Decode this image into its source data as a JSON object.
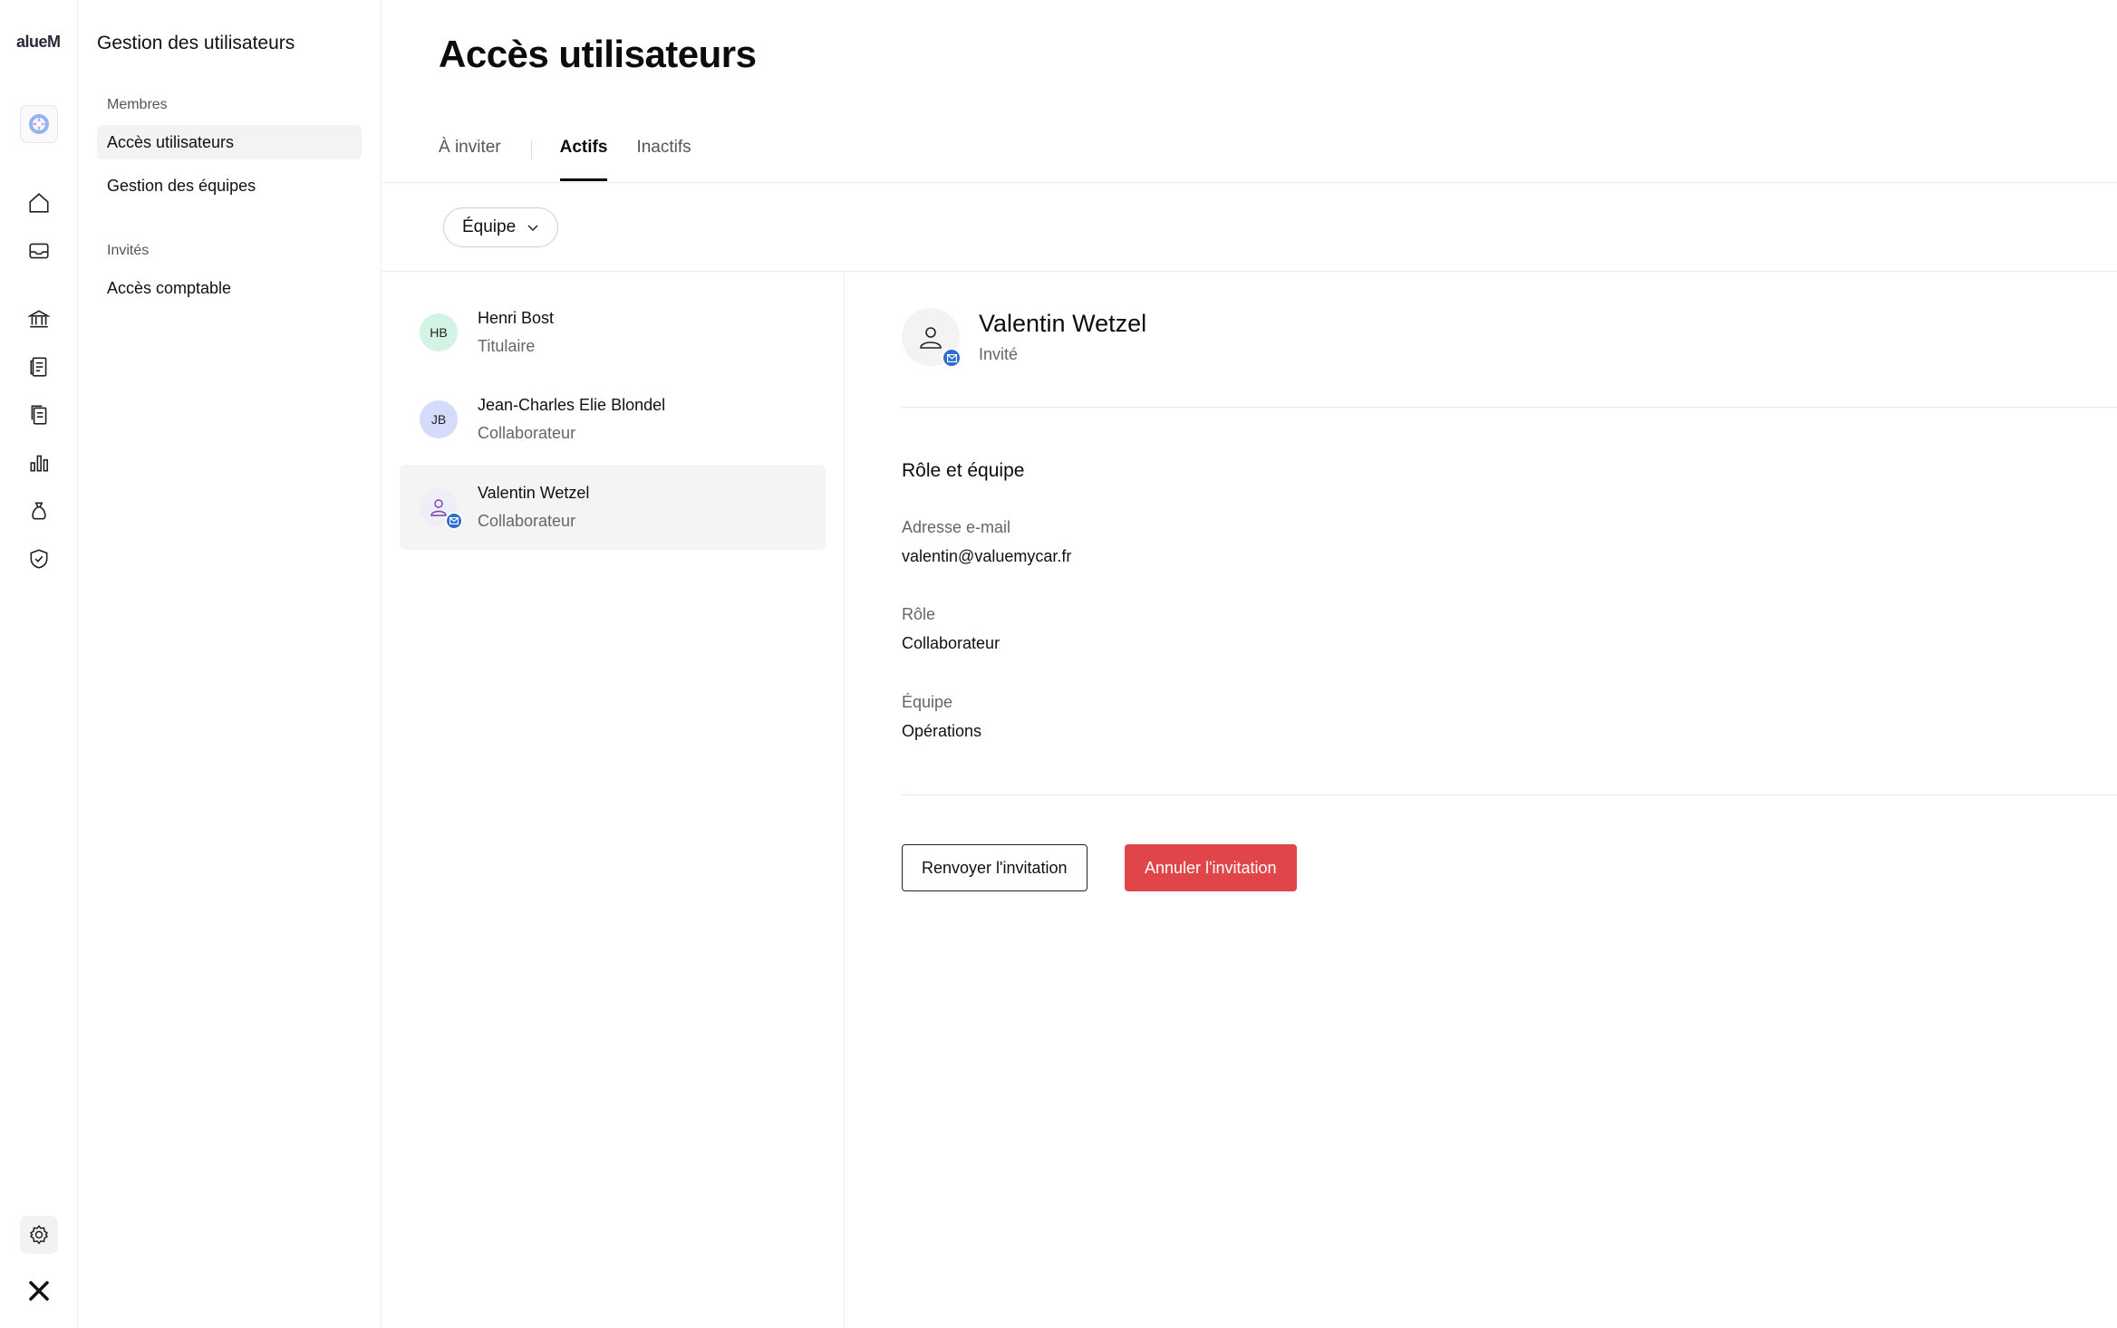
{
  "app": {
    "logo_text": "alueM"
  },
  "subnav": {
    "title": "Gestion des utilisateurs",
    "sections": [
      {
        "label": "Membres",
        "items": [
          "Accès utilisateurs",
          "Gestion des équipes"
        ]
      },
      {
        "label": "Invités",
        "items": [
          "Accès comptable"
        ]
      }
    ],
    "active_item": "Accès utilisateurs"
  },
  "rail": {
    "icons": [
      "home-icon",
      "inbox-icon",
      "bank-icon",
      "invoice-icon",
      "documents-icon",
      "chart-icon",
      "money-bag-icon",
      "shield-icon",
      "settings-icon",
      "brand-icon"
    ]
  },
  "page": {
    "title": "Accès utilisateurs",
    "tabs": [
      "À inviter",
      "Actifs",
      "Inactifs"
    ],
    "active_tab": "Actifs",
    "filter_label": "Équipe"
  },
  "users": [
    {
      "initials": "HB",
      "name": "Henri Bost",
      "role": "Titulaire"
    },
    {
      "initials": "JB",
      "name": "Jean-Charles Elie Blondel",
      "role": "Collaborateur"
    },
    {
      "initials": "",
      "name": "Valentin Wetzel",
      "role": "Collaborateur",
      "selected": true,
      "invited": true
    }
  ],
  "detail": {
    "name": "Valentin Wetzel",
    "status": "Invité",
    "section_title": "Rôle et équipe",
    "email_label": "Adresse e-mail",
    "email": "valentin@valuemycar.fr",
    "role_label": "Rôle",
    "role": "Collaborateur",
    "team_label": "Équipe",
    "team": "Opérations",
    "resend_label": "Renvoyer l'invitation",
    "cancel_label": "Annuler l'invitation"
  },
  "colors": {
    "danger": "#e0454a",
    "badge_blue": "#2f6ccf",
    "avatar_hb": "#d3f3e4",
    "avatar_jb": "#d5dcfb"
  }
}
